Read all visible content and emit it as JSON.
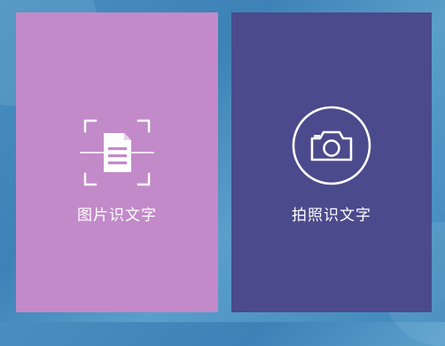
{
  "colors": {
    "card_left_bg": "#c28ac8",
    "card_right_bg": "#4a4a8c",
    "icon_color": "#ffffff"
  },
  "cards": [
    {
      "label": "图片识文字",
      "icon": "document-scan-icon"
    },
    {
      "label": "拍照识文字",
      "icon": "camera-icon"
    }
  ]
}
